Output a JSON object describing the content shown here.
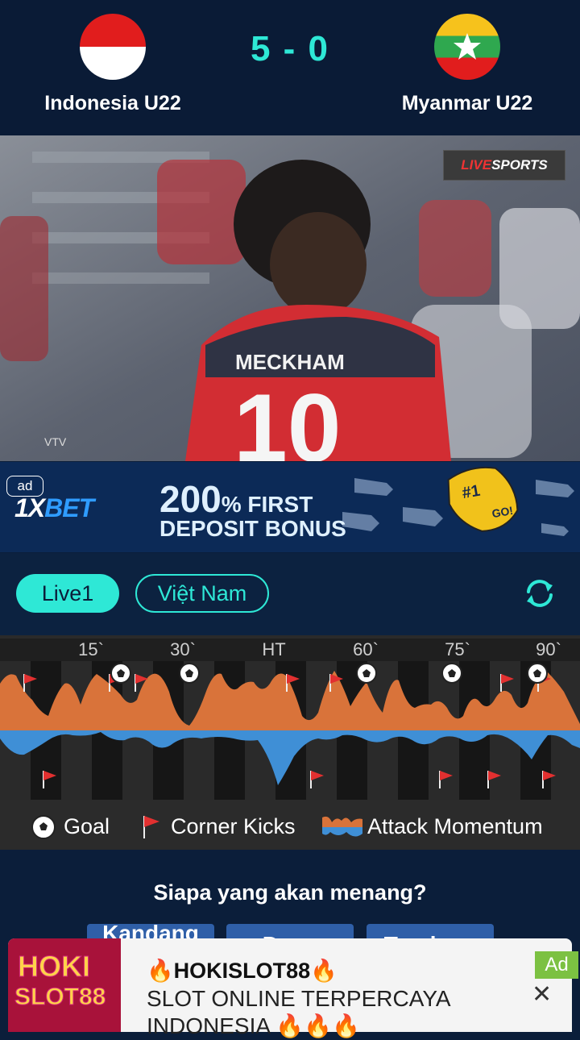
{
  "match": {
    "home_team": "Indonesia U22",
    "away_team": "Myanmar U22",
    "score": "5 - 0"
  },
  "video": {
    "broadcaster_live": "LIVE",
    "broadcaster_sports": "SPORTS",
    "watermark": "VTV"
  },
  "ad_banner": {
    "badge": "ad",
    "brand_prefix": "1X",
    "brand_suffix": "BET",
    "promo_amount": "200",
    "promo_line1_rest": "% FIRST",
    "promo_line2": "DEPOSIT BONUS"
  },
  "tabs": {
    "live1": "Live1",
    "vietnam": "Việt Nam"
  },
  "momentum": {
    "minutes": [
      "15`",
      "30`",
      "HT",
      "60`",
      "75`",
      "90`"
    ],
    "colors": {
      "home": "#d9733a",
      "away": "#3f8fd6"
    },
    "icons": {
      "goal": "soccer-ball-icon",
      "corner": "corner-flag-icon"
    }
  },
  "legend": {
    "goal": "Goal",
    "corner": "Corner Kicks",
    "attack": "Attack Momentum"
  },
  "poll": {
    "title": "Siapa yang akan menang?",
    "options": [
      "Kandang",
      "Draw",
      "Tandang"
    ]
  },
  "bottom_ad": {
    "thumb_line1": "HOKI",
    "thumb_line2": "SLOT88",
    "title": "🔥HOKISLOT88🔥",
    "description": "SLOT ONLINE TERPERCAYA INDONESIA 🔥🔥🔥",
    "close": "✕",
    "corner_label": "Ad"
  }
}
